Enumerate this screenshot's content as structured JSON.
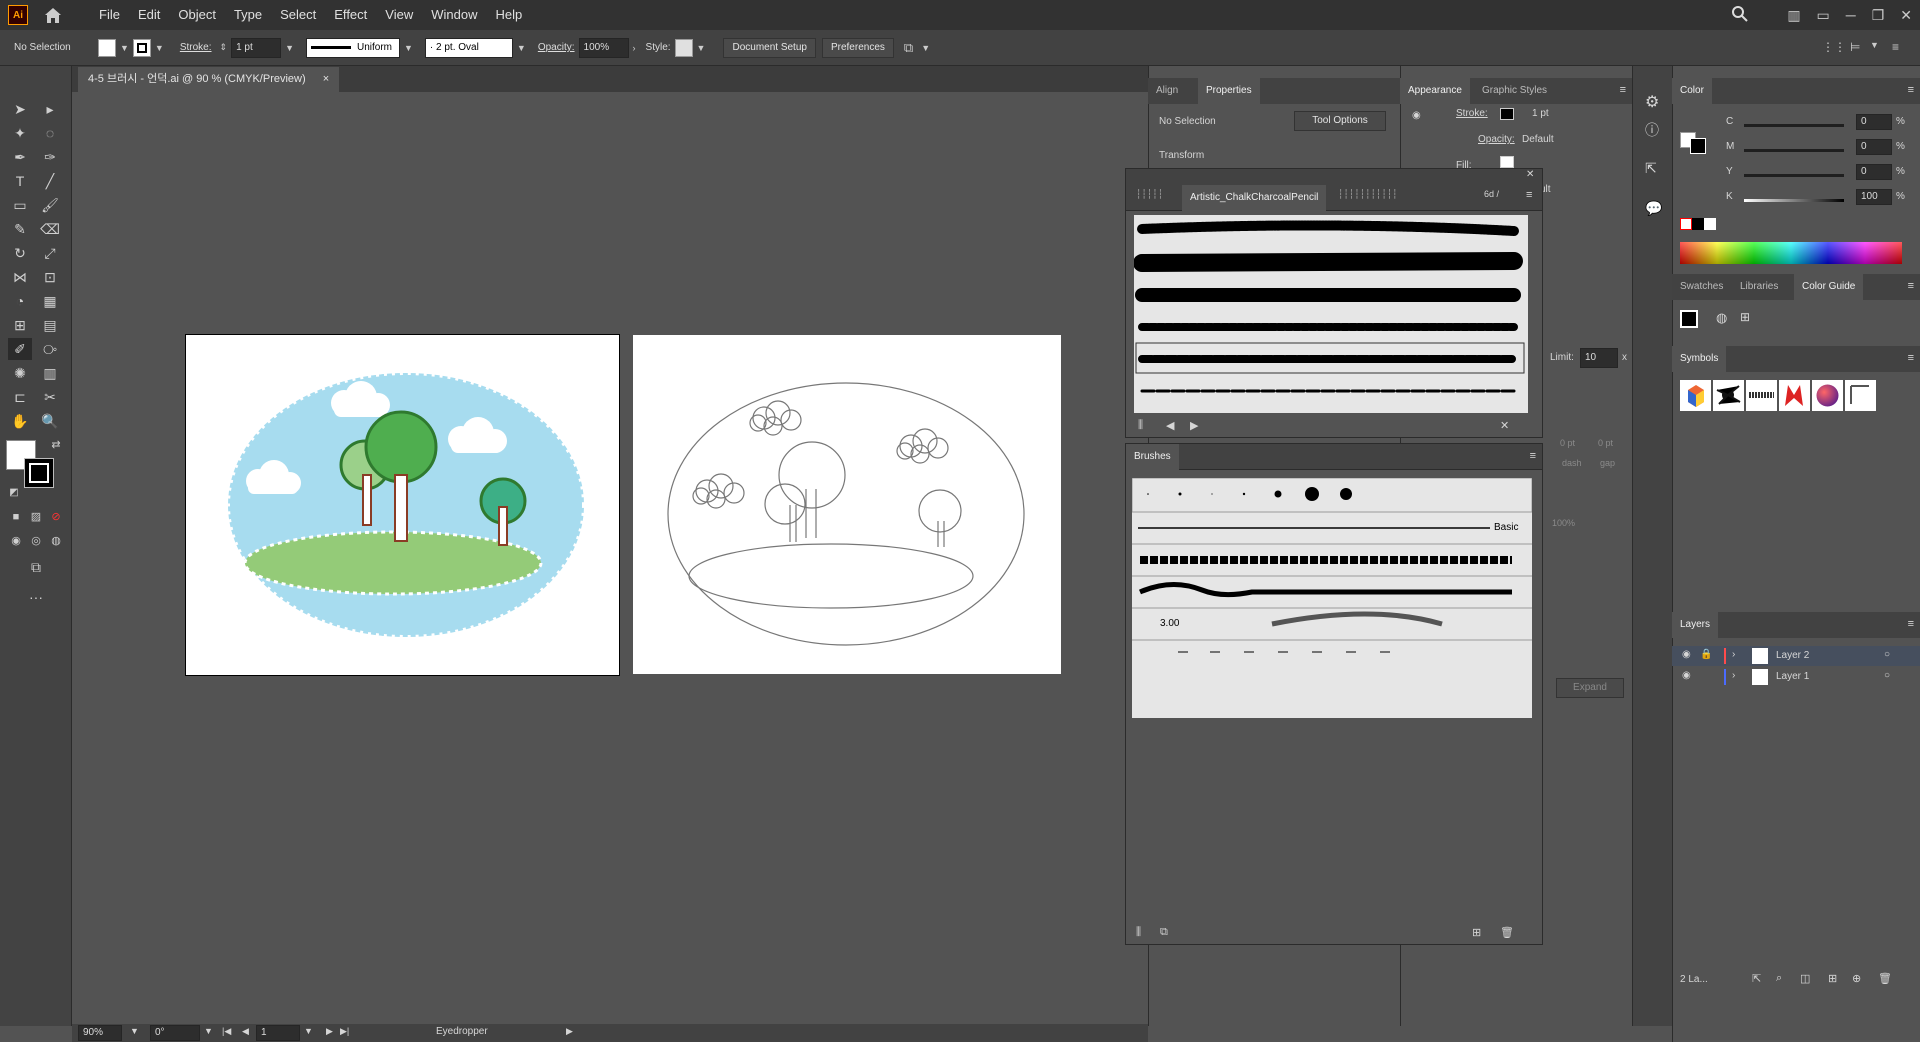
{
  "app": {
    "logo_text": "Ai"
  },
  "menu": {
    "items": [
      "File",
      "Edit",
      "Object",
      "Type",
      "Select",
      "Effect",
      "View",
      "Window",
      "Help"
    ]
  },
  "control": {
    "selection": "No Selection",
    "stroke_label": "Stroke:",
    "stroke_value": "1 pt",
    "profile": "Uniform",
    "brush": "2 pt. Oval",
    "opacity_label": "Opacity:",
    "opacity_value": "100%",
    "style_label": "Style:",
    "doc_setup": "Document Setup",
    "preferences": "Preferences"
  },
  "document": {
    "tab_title": "4-5 브러시 - 언덕.ai @ 90 % (CMYK/Preview)",
    "close": "×"
  },
  "status": {
    "zoom": "90%",
    "rotation": "0°",
    "artboard": "1",
    "tool": "Eyedropper"
  },
  "props_panel": {
    "tabs": [
      "Align",
      "Properties"
    ],
    "no_selection": "No Selection",
    "tool_options": "Tool Options",
    "transform": "Transform",
    "limit_label": "Limit:",
    "limit_value": "10",
    "x_label": "x",
    "pt1": "0 pt",
    "pt2": "0 pt",
    "dash": "dash",
    "gap": "gap",
    "pct": "100%",
    "expand": "Expand"
  },
  "appearance_panel": {
    "tabs": [
      "Appearance",
      "Graphic Styles"
    ],
    "stroke_label": "Stroke:",
    "stroke_value": "1 pt",
    "opacity_label": "Opacity:",
    "opacity_value": "Default",
    "fill_label": "Fill:",
    "partial_text": "ult"
  },
  "brush_library": {
    "title": "Artistic_ChalkCharcoalPencil",
    "partial_tab": "6d /"
  },
  "brushes_panel": {
    "title": "Brushes",
    "basic_label": "Basic",
    "size_value": "3.00"
  },
  "color_panel": {
    "title": "Color",
    "channels": [
      {
        "label": "C",
        "value": "0",
        "unit": "%"
      },
      {
        "label": "M",
        "value": "0",
        "unit": "%"
      },
      {
        "label": "Y",
        "value": "0",
        "unit": "%"
      },
      {
        "label": "K",
        "value": "100",
        "unit": "%"
      }
    ]
  },
  "swatch_tabs": [
    "Swatches",
    "Libraries",
    "Color Guide"
  ],
  "symbols_panel": {
    "title": "Symbols"
  },
  "layers_panel": {
    "title": "Layers",
    "layers": [
      {
        "name": "Layer 2",
        "color": "#ff4b4b"
      },
      {
        "name": "Layer 1",
        "color": "#4b6bff"
      }
    ],
    "count": "2 La..."
  }
}
